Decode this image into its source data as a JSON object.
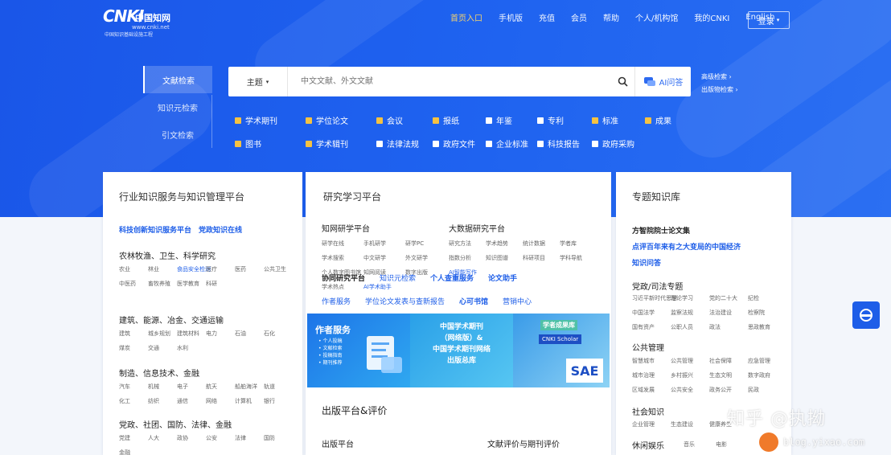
{
  "logo": {
    "mark": "CNKI",
    "name_cn": "中国知网",
    "url": "www.cnki.net",
    "slogan": "中国知识基础设施工程"
  },
  "topnav": [
    {
      "label": "首页入口",
      "active": true
    },
    {
      "label": "手机版"
    },
    {
      "label": "充值"
    },
    {
      "label": "会员"
    },
    {
      "label": "帮助"
    },
    {
      "label": "个人/机构馆"
    },
    {
      "label": "我的CNKI"
    },
    {
      "label": "English"
    }
  ],
  "login": {
    "label": "登录"
  },
  "side_tabs": [
    "文献检索",
    "知识元检索",
    "引文检索"
  ],
  "search": {
    "scope": "主题",
    "placeholder": "中文文献、外文文献",
    "ai_label": "AI问答"
  },
  "advanced": {
    "line1": "高级检索",
    "line2": "出版物检索"
  },
  "db_row1": [
    {
      "label": "学术期刊",
      "on": true
    },
    {
      "label": "学位论文",
      "on": true
    },
    {
      "label": "会议",
      "on": true
    },
    {
      "label": "报纸",
      "on": true
    },
    {
      "label": "年鉴",
      "on": false
    },
    {
      "label": "专利",
      "on": false
    },
    {
      "label": "标准",
      "on": true
    },
    {
      "label": "成果",
      "on": true
    }
  ],
  "db_row2": [
    {
      "label": "图书",
      "on": true
    },
    {
      "label": "学术辑刊",
      "on": true
    },
    {
      "label": "法律法规",
      "on": false
    },
    {
      "label": "政府文件",
      "on": false
    },
    {
      "label": "企业标准",
      "on": false
    },
    {
      "label": "科技报告",
      "on": false
    },
    {
      "label": "政府采购",
      "on": false
    }
  ],
  "card_left": {
    "title": "行业知识服务与知识管理平台",
    "highlights": "科技创新知识服务平台　党政知识在线",
    "groups": [
      {
        "title": "农林牧渔、卫生、科学研究",
        "items": [
          "农业",
          "林业",
          "食品安全检测",
          "医疗",
          "医药",
          "公共卫生",
          "中医药",
          "畜牧养殖",
          "医学教育",
          "科研"
        ]
      },
      {
        "title": "建筑、能源、冶金、交通运输",
        "items": [
          "建筑",
          "城乡规划",
          "建筑材料",
          "电力",
          "石油",
          "石化",
          "煤炭",
          "交通",
          "水利"
        ]
      },
      {
        "title": "制造、信息技术、金融",
        "items": [
          "汽车",
          "机械",
          "电子",
          "航天",
          "船舶海洋",
          "轨道",
          "化工",
          "纺织",
          "通信",
          "网络",
          "计算机",
          "银行"
        ]
      },
      {
        "title": "党政、社团、国防、法律、金融",
        "items": [
          "党建",
          "人大",
          "政协",
          "公安",
          "法律",
          "国防",
          "金融"
        ]
      }
    ]
  },
  "card_mid": {
    "title": "研究学习平台",
    "sub1": "知网研学平台",
    "sub2": "大数据研究平台",
    "grid1": [
      "研学在线",
      "手机研学",
      "研学PC",
      "学术搜索",
      "中文研学",
      "外文研学",
      "个人数字图书馆",
      "知网阅读",
      "数字出版",
      "学术热点",
      "AI学术助手"
    ],
    "grid2": [
      "研究方法",
      "学术趋势",
      "统计数据",
      "学者库",
      "指数分析",
      "知识图谱",
      "科研项目",
      "学科导航",
      "AI智能写作"
    ],
    "links_row1": [
      "协同研究平台",
      "知识元检索",
      "个人查重服务",
      "论文助手"
    ],
    "links_row2": [
      "作者服务",
      "学位论文发表与查新报告",
      "心可书馆",
      "营销中心"
    ],
    "banner": {
      "b1_title": "作者服务",
      "b1_items": [
        "个人投稿",
        "文献检索",
        "投稿指南",
        "期刊推荐"
      ],
      "b2_line1": "中国学术期刊",
      "b2_line2": "（网络版）&",
      "b2_line3": "中国学术期刊网络",
      "b2_line4": "出版总库",
      "b3_title": "学者成果库",
      "b3_sub": "CNKI Scholar",
      "b3_logo": "SAE"
    },
    "section2": "出版平台&评价",
    "sub3": "出版平台",
    "sub4": "文献评价与期刊评价"
  },
  "card_right": {
    "title": "专题知识库",
    "highlights": [
      "方智院院士论文集",
      "点评百年来有之大变局的中国经济",
      "知识问答"
    ],
    "group1": {
      "title": "党政/司法专题",
      "items": [
        "习近平新时代思想",
        "理论学习",
        "党的二十大",
        "纪检",
        "中国法学",
        "监察法规",
        "法治建设",
        "检察院",
        "国有资产",
        "公职人员",
        "政法",
        "思政教育"
      ]
    },
    "group2": {
      "title": "公共管理",
      "items": [
        "智慧城市",
        "公共管理",
        "社会保障",
        "应急管理",
        "城市治理",
        "乡村振兴",
        "生态文明",
        "数字政府",
        "区域发展",
        "公共安全",
        "政务公开",
        "民政"
      ]
    },
    "group3": {
      "title": "社会知识",
      "items": [
        "企业管理",
        "生态建设",
        "健康养生"
      ]
    },
    "group4": {
      "title": "休闲娱乐",
      "items": [
        "音乐",
        "电影"
      ]
    }
  },
  "watermark": {
    "text": "知乎 @执拗",
    "site": "blog.yixao.com"
  },
  "colors": {
    "hero": "#1f63f0",
    "accent": "#1e5ee8",
    "checked": "#f5c242"
  }
}
